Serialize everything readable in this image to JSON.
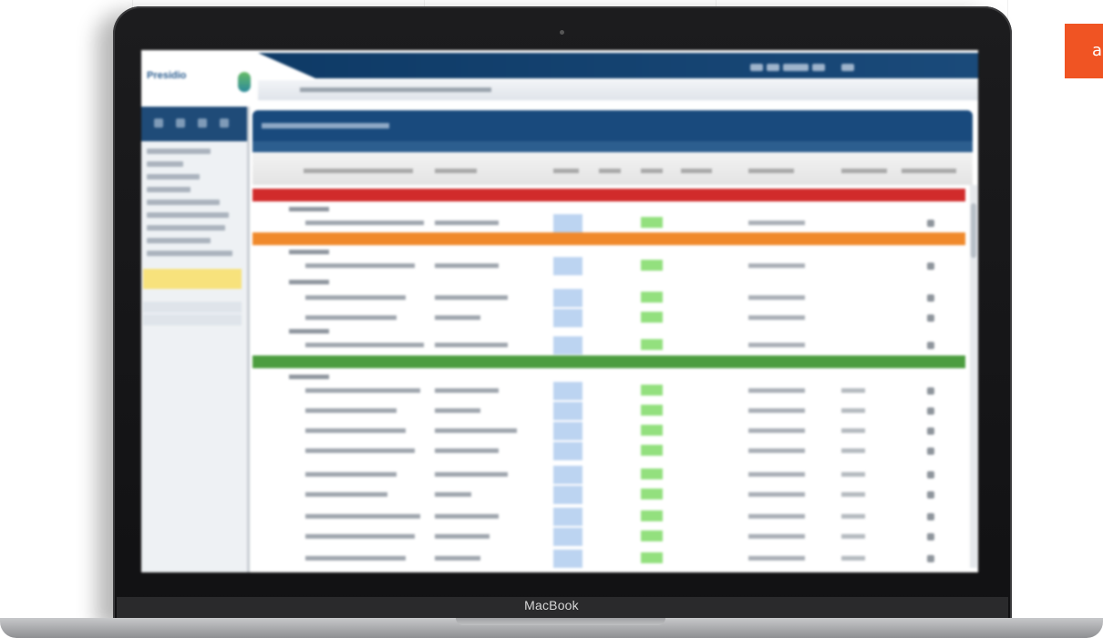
{
  "cta": {
    "label": "a",
    "color": "#f05423"
  },
  "device": {
    "label": "MacBook"
  },
  "app": {
    "logo_text": "Presidio",
    "subtitle": "",
    "title": "",
    "bands": [
      {
        "name": "red",
        "color": "#d12b2b"
      },
      {
        "name": "orange",
        "color": "#f0892b"
      },
      {
        "name": "green",
        "color": "#4c9d3f"
      }
    ]
  }
}
